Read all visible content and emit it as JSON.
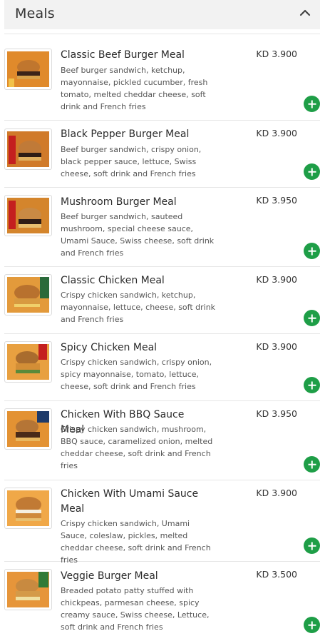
{
  "section": {
    "title": "Meals",
    "collapse_icon": "chevron-up-icon"
  },
  "currency": "KD",
  "accent_color": "#1e9e47",
  "items": [
    {
      "name": "Classic Beef Burger Meal",
      "description": "Beef burger sandwich, ketchup, mayonnaise, pickled cucumber, fresh tomato, melted cheddar cheese, soft drink and French fries",
      "price": "KD 3.900"
    },
    {
      "name": "Black Pepper Burger Meal",
      "description": "Beef burger sandwich, crispy onion, black pepper sauce, lettuce, Swiss cheese, soft drink and French fries",
      "price": "KD 3.900"
    },
    {
      "name": "Mushroom Burger Meal",
      "description": "Beef burger sandwich, sauteed mushroom, special cheese sauce, Umami Sauce, Swiss cheese, soft drink and French fries",
      "price": "KD 3.950"
    },
    {
      "name": "Classic Chicken Meal",
      "description": "Crispy chicken sandwich, ketchup, mayonnaise, lettuce, cheese, soft drink and French fries",
      "price": "KD 3.900"
    },
    {
      "name": "Spicy Chicken Meal",
      "description": "Crispy chicken sandwich, crispy onion, spicy mayonnaise, tomato, lettuce, cheese, soft drink and French fries",
      "price": "KD 3.900"
    },
    {
      "name": "Chicken With BBQ Sauce Meal",
      "description": "Crispy chicken sandwich, mushroom, BBQ sauce, caramelized onion, melted cheddar cheese, soft drink and French fries",
      "price": "KD 3.950"
    },
    {
      "name": "Chicken With Umami Sauce Meal",
      "description": "Crispy chicken sandwich, Umami Sauce, coleslaw, pickles, melted cheddar cheese, soft drink and French fries",
      "price": "KD 3.900"
    },
    {
      "name": "Veggie Burger Meal",
      "description": "Breaded potato patty stuffed with chickpeas, parmesan cheese, spicy creamy sauce, Swiss cheese, Lettuce, soft drink and French fries",
      "price": "KD 3.500"
    }
  ]
}
